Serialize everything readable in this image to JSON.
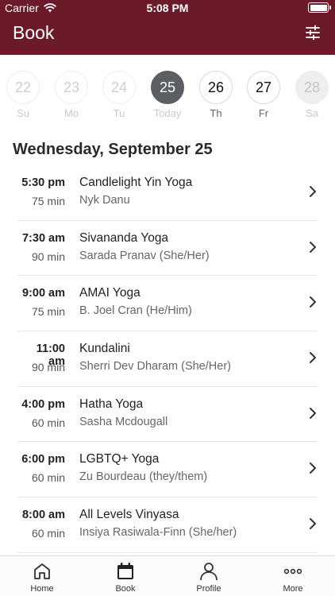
{
  "status": {
    "carrier": "Carrier",
    "time": "5:08 PM"
  },
  "header": {
    "title": "Book"
  },
  "days": [
    {
      "num": "22",
      "label": "Su"
    },
    {
      "num": "23",
      "label": "Mo"
    },
    {
      "num": "24",
      "label": "Tu"
    },
    {
      "num": "25",
      "label": "Today"
    },
    {
      "num": "26",
      "label": "Th"
    },
    {
      "num": "27",
      "label": "Fr"
    },
    {
      "num": "28",
      "label": "Sa"
    }
  ],
  "date_heading": "Wednesday, September 25",
  "classes": [
    {
      "time": "5:30 pm",
      "duration": "75 min",
      "name": "Candlelight Yin Yoga",
      "instructor": "Nyk Danu"
    },
    {
      "time": "7:30 am",
      "duration": "90 min",
      "name": "Sivananda Yoga",
      "instructor": "Sarada Pranav (She/Her)"
    },
    {
      "time": "9:00 am",
      "duration": "75 min",
      "name": "AMAI Yoga",
      "instructor": "B. Joel Cran (He/Him)"
    },
    {
      "time": "11:00 am",
      "duration": "90 min",
      "name": "Kundalini",
      "instructor": "Sherri Dev Dharam (She/Her)"
    },
    {
      "time": "4:00 pm",
      "duration": "60 min",
      "name": "Hatha Yoga",
      "instructor": "Sasha Mcdougall"
    },
    {
      "time": "6:00 pm",
      "duration": "60 min",
      "name": "LGBTQ+ Yoga",
      "instructor": "Zu Bourdeau (they/them)"
    },
    {
      "time": "8:00 am",
      "duration": "60 min",
      "name": "All Levels Vinyasa",
      "instructor": "Insiya Rasiwala-Finn (She/her)"
    }
  ],
  "tabs": [
    {
      "label": "Home",
      "icon": "home-icon"
    },
    {
      "label": "Book",
      "icon": "calendar-icon"
    },
    {
      "label": "Profile",
      "icon": "person-icon"
    },
    {
      "label": "More",
      "icon": "more-icon"
    }
  ],
  "colors": {
    "brand": "#6b1a2a",
    "active_day": "#5d5e63"
  }
}
